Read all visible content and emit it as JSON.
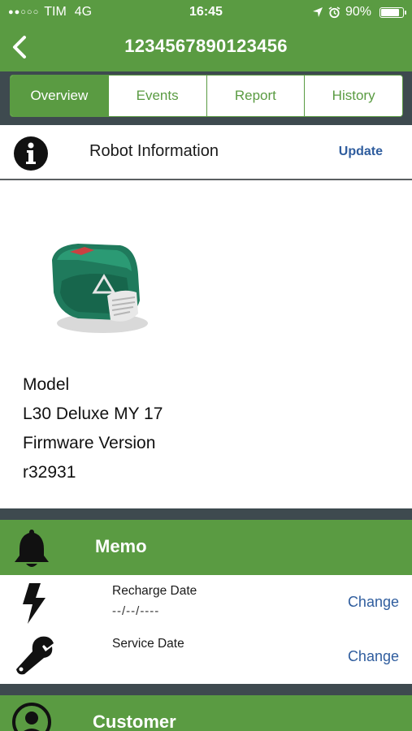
{
  "status_bar": {
    "carrier": "TIM",
    "network": "4G",
    "time": "16:45",
    "battery": "90%",
    "battery_level": 0.9
  },
  "nav": {
    "title": "1234567890123456",
    "back_icon": "chevron-left-icon"
  },
  "tabs": [
    {
      "label": "Overview",
      "active": true
    },
    {
      "label": "Events",
      "active": false
    },
    {
      "label": "Report",
      "active": false
    },
    {
      "label": "History",
      "active": false
    }
  ],
  "robot_info": {
    "title": "Robot Information",
    "update_label": "Update",
    "icon": "info-icon",
    "model_label": "Model",
    "model_value": "L30 Deluxe MY 17",
    "firmware_label": "Firmware Version",
    "firmware_value": "r32931"
  },
  "memo": {
    "title": "Memo",
    "icon": "bell-icon",
    "recharge_label": "Recharge Date",
    "recharge_value": "--/--/----",
    "recharge_change": "Change",
    "service_label": "Service Date",
    "service_change": "Change"
  },
  "customer": {
    "title": "Customer",
    "icon": "user-icon"
  },
  "colors": {
    "brand_green": "#5a9b42",
    "dark_divider": "#3e4a4f",
    "link_blue": "#2f5d9e"
  }
}
